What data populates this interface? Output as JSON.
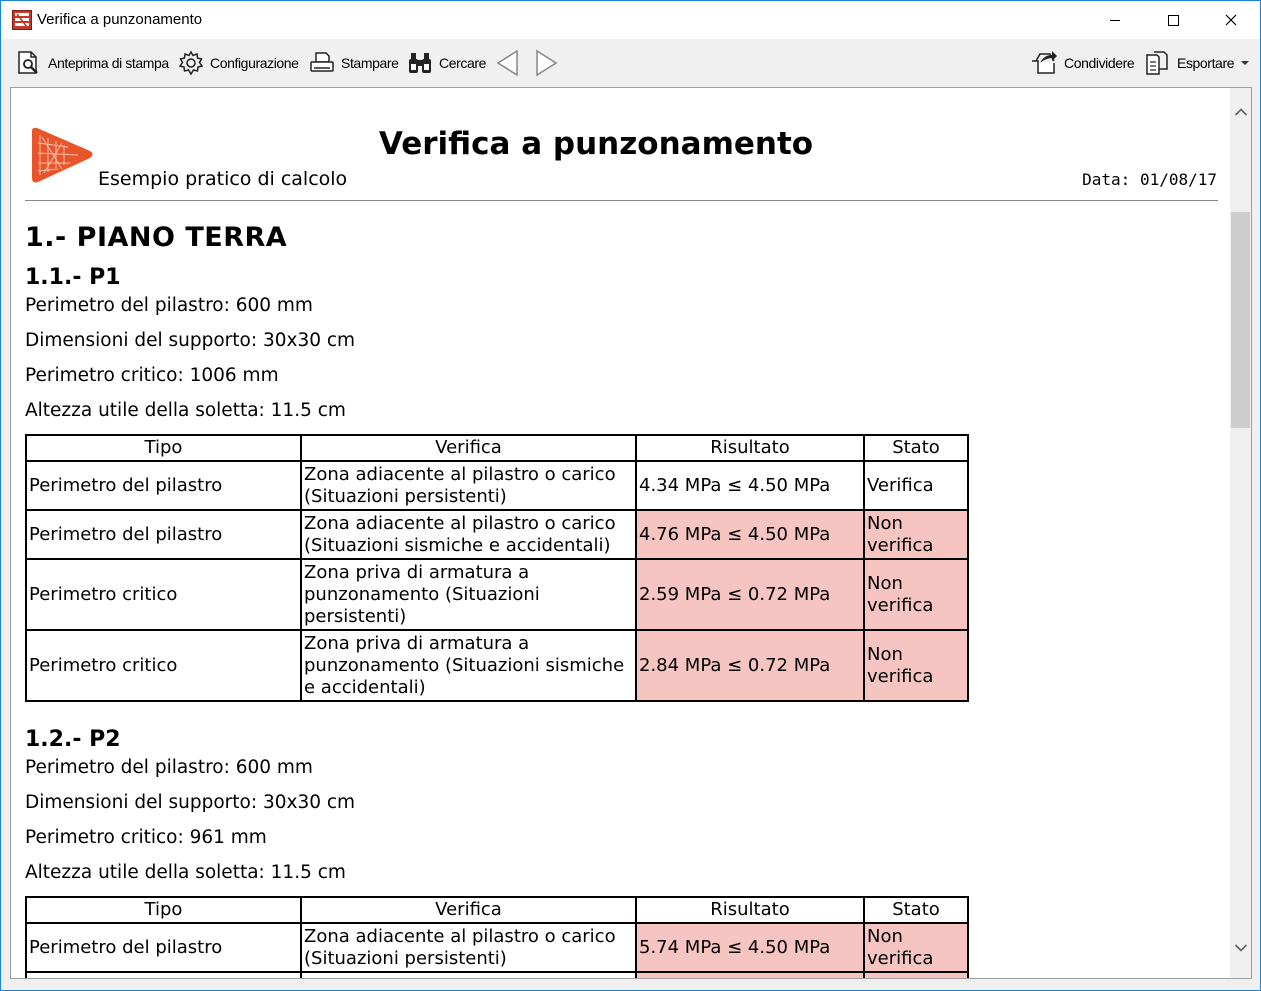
{
  "window": {
    "title": "Verifica a punzonamento"
  },
  "toolbar": {
    "preview_label": "Anteprima di stampa",
    "config_label": "Configurazione",
    "print_label": "Stampare",
    "search_label": "Cercare",
    "share_label": "Condividere",
    "export_label": "Esportare"
  },
  "report": {
    "title": "Verifica a punzonamento",
    "subtitle": "Esempio pratico di calcolo",
    "date": "Data: 01/08/17",
    "section_title": "1.- PIANO TERRA",
    "table_headers": [
      "Tipo",
      "Verifica",
      "Risultato",
      "Stato"
    ],
    "columns": [
      {
        "heading": "1.1.- P1",
        "lines": [
          "Perimetro del pilastro: 600 mm",
          "Dimensioni del supporto: 30x30 cm",
          "Perimetro critico: 1006 mm",
          "Altezza utile della soletta: 11.5 cm"
        ],
        "rows": [
          {
            "tipo": "Perimetro del pilastro",
            "verifica": "Zona adiacente al pilastro o carico (Situazioni persistenti)",
            "risultato": "4.34 MPa ≤ 4.50 MPa",
            "stato": "Verifica",
            "ok": true
          },
          {
            "tipo": "Perimetro del pilastro",
            "verifica": "Zona adiacente al pilastro o carico (Situazioni sismiche e accidentali)",
            "risultato": "4.76 MPa ≤ 4.50 MPa",
            "stato": "Non verifica",
            "ok": false
          },
          {
            "tipo": "Perimetro critico",
            "verifica": "Zona priva di armatura a punzonamento (Situazioni persistenti)",
            "risultato": "2.59 MPa ≤ 0.72 MPa",
            "stato": "Non verifica",
            "ok": false
          },
          {
            "tipo": "Perimetro critico",
            "verifica": "Zona priva di armatura a punzonamento (Situazioni sismiche e accidentali)",
            "risultato": "2.84 MPa ≤ 0.72 MPa",
            "stato": "Non verifica",
            "ok": false
          }
        ]
      },
      {
        "heading": "1.2.- P2",
        "lines": [
          "Perimetro del pilastro: 600 mm",
          "Dimensioni del supporto: 30x30 cm",
          "Perimetro critico: 961 mm",
          "Altezza utile della soletta: 11.5 cm"
        ],
        "rows": [
          {
            "tipo": "Perimetro del pilastro",
            "verifica": "Zona adiacente al pilastro o carico (Situazioni persistenti)",
            "risultato": "5.74 MPa ≤ 4.50 MPa",
            "stato": "Non verifica",
            "ok": false
          },
          {
            "tipo": "",
            "verifica": "",
            "risultato": "",
            "stato": "",
            "ok": false
          }
        ]
      }
    ]
  },
  "colors": {
    "fail_bg": "#f6c5c2",
    "logo": "#e8552a"
  }
}
